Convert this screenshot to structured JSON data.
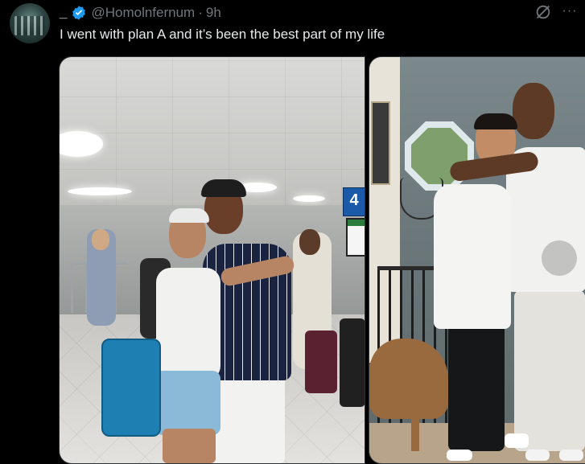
{
  "post": {
    "display_name": "_",
    "handle": "@Homolnfernum",
    "separator": "·",
    "time": "9h",
    "text": "I went with plan A and it’s been the best part of my life",
    "more_glyph": "···"
  },
  "media": {
    "photo_1": {
      "sign_number": "4"
    }
  },
  "colors": {
    "background": "#000000",
    "text_primary": "#e7e9ea",
    "text_secondary": "#71767b",
    "verified_blue": "#1d9bf0"
  },
  "icons": {
    "verified": "verified-badge-icon",
    "grok": "grok-icon",
    "more": "more-options-icon"
  }
}
